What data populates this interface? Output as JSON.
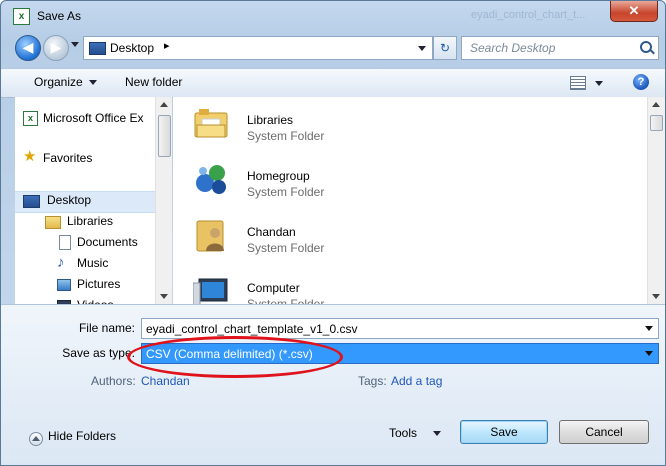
{
  "window": {
    "title": "Save As",
    "title_faded": "eyadi_control_chart_t...",
    "close_glyph": "✕"
  },
  "address": {
    "back_glyph": "◀",
    "forward_glyph": "▶",
    "location": "Desktop",
    "separator": "▸",
    "refresh_glyph": "↻",
    "search_placeholder": "Search Desktop"
  },
  "toolbar": {
    "organize_label": "Organize",
    "new_folder_label": "New folder",
    "help_glyph": "?"
  },
  "nav_pane": {
    "items": [
      {
        "label": "Microsoft Office Ex",
        "icon": "excel-icon"
      },
      {
        "label": "Favorites",
        "icon": "star-icon"
      },
      {
        "label": "Desktop",
        "icon": "desktop-icon"
      },
      {
        "label": "Libraries",
        "icon": "libraries-icon"
      },
      {
        "label": "Documents",
        "icon": "documents-icon"
      },
      {
        "label": "Music",
        "icon": "music-icon"
      },
      {
        "label": "Pictures",
        "icon": "pictures-icon"
      },
      {
        "label": "Videos",
        "icon": "videos-icon"
      }
    ]
  },
  "files": [
    {
      "name": "Libraries",
      "type": "System Folder",
      "icon": "libraries-folder-icon"
    },
    {
      "name": "Homegroup",
      "type": "System Folder",
      "icon": "homegroup-icon"
    },
    {
      "name": "Chandan",
      "type": "System Folder",
      "icon": "user-folder-icon"
    },
    {
      "name": "Computer",
      "type": "System Folder",
      "icon": "computer-icon"
    }
  ],
  "form": {
    "file_name_label": "File name:",
    "file_name_value": "eyadi_control_chart_template_v1_0.csv",
    "save_type_label": "Save as type:",
    "save_type_value": "CSV (Comma delimited) (*.csv)",
    "authors_label": "Authors:",
    "authors_value": "Chandan",
    "tags_label": "Tags:",
    "tags_value": "Add a tag"
  },
  "footer": {
    "hide_folders_label": "Hide Folders",
    "tools_label": "Tools",
    "save_label": "Save",
    "cancel_label": "Cancel"
  },
  "colors": {
    "selection_blue": "#3399ff",
    "annotation_red": "#e0121b",
    "link_blue": "#1f58b8"
  }
}
